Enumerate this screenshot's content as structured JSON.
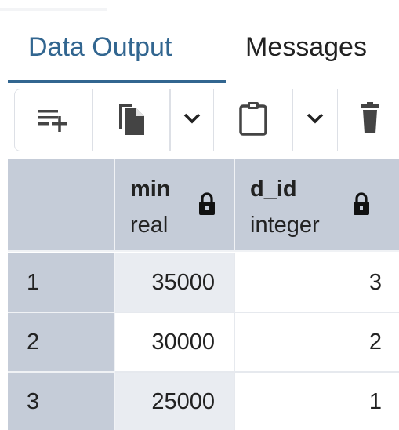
{
  "tabs": [
    {
      "label": "Data Output",
      "active": true
    },
    {
      "label": "Messages",
      "active": false
    }
  ],
  "toolbar": {
    "buttons": [
      {
        "icon": "add-row-icon"
      },
      {
        "icon": "copy-icon"
      },
      {
        "icon": "chevron-down-icon"
      },
      {
        "icon": "paste-icon"
      },
      {
        "icon": "chevron-down-icon"
      },
      {
        "icon": "delete-icon"
      }
    ]
  },
  "grid": {
    "columns": [
      {
        "name": "min",
        "type": "real",
        "locked": true
      },
      {
        "name": "d_id",
        "type": "integer",
        "locked": true
      }
    ],
    "rows": [
      {
        "num": "1",
        "cells": [
          "35000",
          "3"
        ]
      },
      {
        "num": "2",
        "cells": [
          "30000",
          "2"
        ]
      },
      {
        "num": "3",
        "cells": [
          "25000",
          "1"
        ]
      }
    ]
  },
  "colors": {
    "accent": "#326690",
    "header_bg": "#c5ccd8",
    "text": "#222222"
  }
}
